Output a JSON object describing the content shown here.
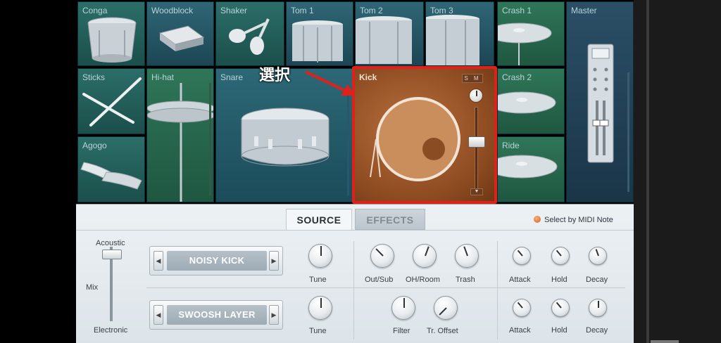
{
  "annotation": {
    "label": "選択"
  },
  "pads": {
    "conga": "Conga",
    "woodblock": "Woodblock",
    "shaker": "Shaker",
    "tom1": "Tom 1",
    "tom2": "Tom 2",
    "tom3": "Tom 3",
    "crash1": "Crash 1",
    "master": "Master",
    "sticks": "Sticks",
    "hihat": "Hi-hat",
    "snare": "Snare",
    "kick": "Kick",
    "crash2": "Crash 2",
    "agogo": "Agogo",
    "ride": "Ride"
  },
  "kick_controls": {
    "sm_label": "S M",
    "menu_arrow": "▼"
  },
  "tabs": {
    "source": "SOURCE",
    "effects": "EFFECTS"
  },
  "midi_select": "Select by MIDI Note",
  "mix": {
    "top": "Acoustic",
    "middle": "Mix",
    "bottom": "Electronic"
  },
  "layers": [
    {
      "name": "NOISY KICK",
      "prev": "◀",
      "next": "▶"
    },
    {
      "name": "SWOOSH LAYER",
      "prev": "◀",
      "next": "▶"
    }
  ],
  "knobs_row1": {
    "tune": "Tune",
    "outsub": "Out/Sub",
    "ohroom": "OH/Room",
    "trash": "Trash",
    "attack": "Attack",
    "hold": "Hold",
    "decay": "Decay"
  },
  "knobs_row2": {
    "tune": "Tune",
    "filter": "Filter",
    "troffset": "Tr. Offset",
    "attack": "Attack",
    "hold": "Hold",
    "decay": "Decay"
  },
  "colors": {
    "selection": "#e0211b",
    "kick_bg": "#9a5428",
    "panel": "#e4eaee"
  }
}
